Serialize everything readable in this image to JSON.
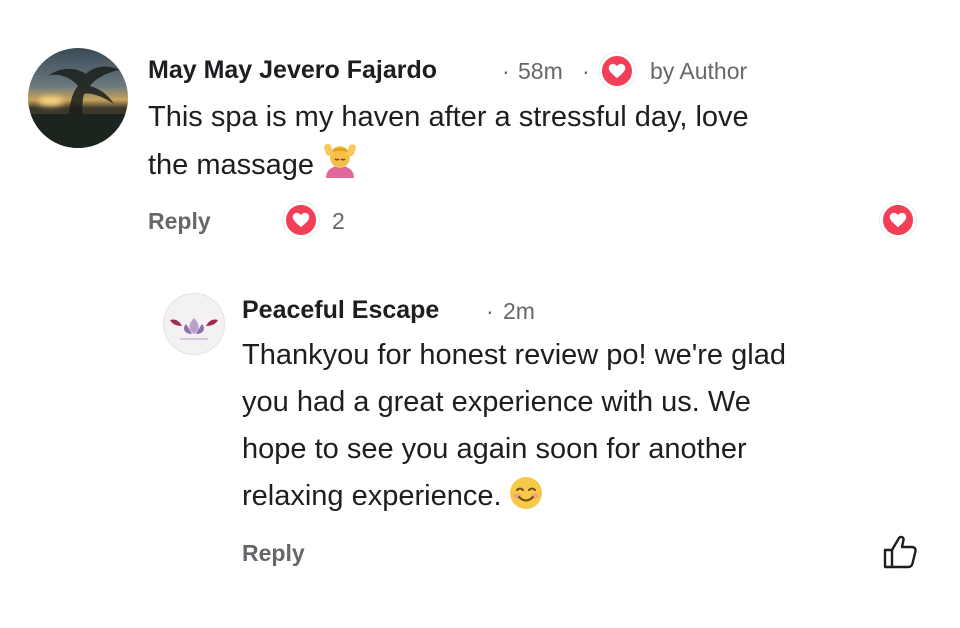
{
  "comment": {
    "author": "May May Jevero Fajardo",
    "time": "58m",
    "author_badge": "by Author",
    "text_line1": "This spa is my haven after a stressful day, love",
    "text_line2": "the massage",
    "reply_label": "Reply",
    "reaction_count": "2"
  },
  "reply": {
    "author": "Peaceful Escape",
    "time": "2m",
    "text_lines": [
      "Thankyou for honest review po! we're glad",
      "you had a great experience with us. We",
      "hope to see you again soon for another",
      "relaxing experience."
    ],
    "reply_label": "Reply"
  },
  "separator": "·",
  "colors": {
    "heart": "#f33e58",
    "text_primary": "#1c1e21",
    "text_secondary": "#65676b"
  },
  "icons": {
    "comment_emoji": "person-getting-massage-emoji",
    "reply_emoji": "smiling-face-emoji",
    "reaction": "heart-icon",
    "like": "thumbs-up-icon"
  }
}
